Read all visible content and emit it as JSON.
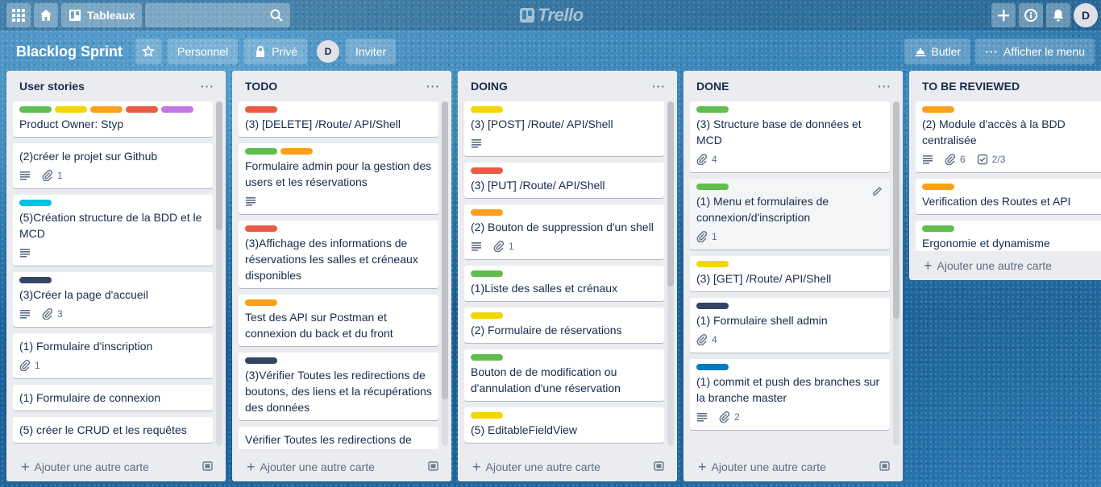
{
  "header": {
    "boards_label": "Tableaux",
    "logo_text": "Trello",
    "user_initial": "D"
  },
  "board": {
    "title": "Blacklog Sprint",
    "visibility_team": "Personnel",
    "visibility_private": "Privé",
    "member_initial": "D",
    "invite_label": "Inviter",
    "butler_label": "Butler",
    "menu_label": "Afficher le menu"
  },
  "colors": {
    "green": "#61bd4f",
    "yellow": "#f2d600",
    "orange": "#ff9f1a",
    "red": "#eb5a46",
    "purple": "#c377e0",
    "sky": "#00c2e0",
    "black": "#344563",
    "blue": "#0079bf"
  },
  "add_card_label": "Ajouter une autre carte",
  "lists": [
    {
      "title": "User stories",
      "cards": [
        {
          "labels": [
            "green",
            "yellow",
            "orange",
            "red",
            "purple"
          ],
          "title": "Product Owner: Styp",
          "desc": false
        },
        {
          "labels": [],
          "title": "(2)créer le projet sur Github",
          "desc": true,
          "attach": "1"
        },
        {
          "labels": [
            "sky"
          ],
          "title": "(5)Création structure de la BDD et le MCD",
          "desc": true
        },
        {
          "labels": [
            "black"
          ],
          "title": "(3)Créer la page d'accueil",
          "desc": true,
          "attach": "3"
        },
        {
          "labels": [],
          "title": "(1) Formulaire d'inscription",
          "desc": false,
          "attach": "1"
        },
        {
          "labels": [],
          "title": "(1) Formulaire de connexion",
          "desc": false
        },
        {
          "labels": [],
          "title": "(5) créer le CRUD et les requêtes",
          "desc": false
        }
      ]
    },
    {
      "title": "TODO",
      "cards": [
        {
          "labels": [
            "red"
          ],
          "title": "(3) [DELETE] /Route/ API/Shell",
          "desc": false
        },
        {
          "labels": [
            "green",
            "orange"
          ],
          "title": "Formulaire admin pour la gestion des users et les réservations",
          "desc": true
        },
        {
          "labels": [
            "red"
          ],
          "title": "(3)Affichage des informations de réservations les salles et créneaux disponibles",
          "desc": false
        },
        {
          "labels": [
            "orange"
          ],
          "title": "Test des API sur Postman et connexion du back et du front",
          "desc": false
        },
        {
          "labels": [
            "black"
          ],
          "title": "(3)Vérifier Toutes les redirections de boutons, des liens et la récupérations des données",
          "desc": false
        },
        {
          "labels": [],
          "title": "Vérifier Toutes les redirections de",
          "desc": false
        }
      ]
    },
    {
      "title": "DOING",
      "cards": [
        {
          "labels": [
            "yellow"
          ],
          "title": "(3) [POST] /Route/ API/Shell",
          "desc": true
        },
        {
          "labels": [
            "red"
          ],
          "title": "(3) [PUT] /Route/ API/Shell",
          "desc": false
        },
        {
          "labels": [
            "orange"
          ],
          "title": "(2) Bouton de suppression d'un shell",
          "desc": true,
          "attach": "1"
        },
        {
          "labels": [
            "green"
          ],
          "title": "(1)Liste des salles et crénaux",
          "desc": false
        },
        {
          "labels": [
            "yellow"
          ],
          "title": "(2) Formulaire de réservations",
          "desc": false
        },
        {
          "labels": [
            "green"
          ],
          "title": "Bouton de de modification ou d'annulation d'une réservation",
          "desc": false
        },
        {
          "labels": [
            "yellow"
          ],
          "title": "(5) EditableFieldView",
          "desc": false
        }
      ]
    },
    {
      "title": "DONE",
      "cards": [
        {
          "labels": [
            "green"
          ],
          "title": "(3) Structure base de données et MCD",
          "desc": false,
          "attach": "4"
        },
        {
          "labels": [
            "green"
          ],
          "title": "(1) Menu et formulaires de connexion/d'inscription",
          "desc": false,
          "attach": "1",
          "hover": true
        },
        {
          "labels": [
            "yellow"
          ],
          "title": "(3) [GET] /Route/ API/Shell",
          "desc": false
        },
        {
          "labels": [
            "black"
          ],
          "title": "(1) Formulaire shell admin",
          "desc": false,
          "attach": "4"
        },
        {
          "labels": [
            "blue"
          ],
          "title": "(1) commit et push des branches sur la branche master",
          "desc": true,
          "attach": "2"
        }
      ]
    },
    {
      "title": "TO BE REVIEWED",
      "cards": [
        {
          "labels": [
            "orange"
          ],
          "title": "(2) Module d'accès à la BDD centralisée",
          "desc": true,
          "attach": "6",
          "checklist": "2/3"
        },
        {
          "labels": [
            "orange"
          ],
          "title": "Verification des Routes et API",
          "desc": false
        },
        {
          "labels": [
            "green"
          ],
          "title": "Ergonomie et dynamisme",
          "desc": false
        }
      ]
    }
  ]
}
